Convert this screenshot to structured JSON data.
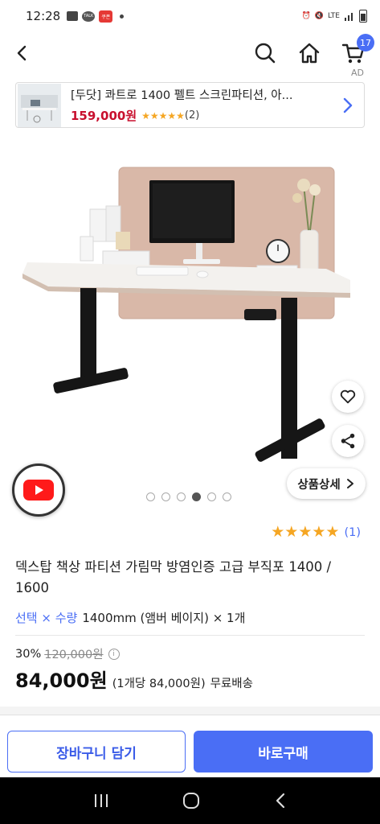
{
  "status_bar": {
    "time": "12:28",
    "talk_label": "TALK",
    "red_label": "쿠폰",
    "net_label": "LTE"
  },
  "nav": {
    "cart_count": "17"
  },
  "ad": {
    "label": "AD",
    "title": "[두닷] 콰트로 1400 펠트 스크린파티션, 아...",
    "price": "159,000원",
    "stars": "★★★★★",
    "reviews": "(2)"
  },
  "gallery": {
    "total": 6,
    "active_index": 3,
    "detail_label": "상품상세"
  },
  "rating": {
    "stars": 5,
    "count": "(1)"
  },
  "product": {
    "title": "덱스탑 책상 파티션 가림막 방염인증 고급 부직포 1400 / 1600",
    "option_label": "선택 × 수량",
    "option_value": "1400mm (앰버 베이지) × 1개",
    "discount": "30%",
    "original_price": "120,000원",
    "final_price": "84,000원",
    "unit_price": "(1개당 84,000원)",
    "shipping": "무료배송"
  },
  "actions": {
    "cart_label": "장바구니 담기",
    "buy_label": "바로구매"
  },
  "colors": {
    "accent": "#4a6ef5",
    "price_red": "#c8102e",
    "star": "#f5a623"
  }
}
